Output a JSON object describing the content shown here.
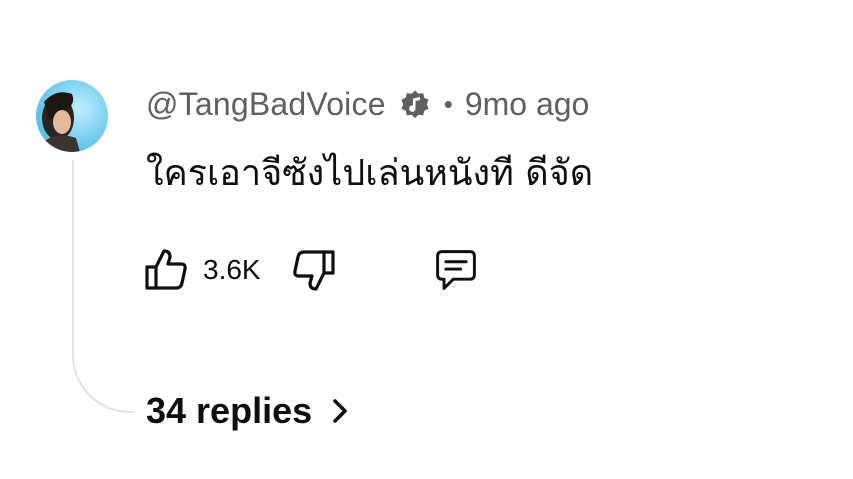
{
  "comment": {
    "author": "@TangBadVoice",
    "badge_icon": "music-note-badge-icon",
    "separator": "•",
    "timestamp": "9mo ago",
    "text": "ใครเอาจีซังไปเล่นหนังที ดีจัด",
    "like_count": "3.6K",
    "icons": {
      "like": "thumbs-up-icon",
      "dislike": "thumbs-down-icon",
      "reply": "reply-comment-icon",
      "replies_chevron": "chevron-right-icon"
    },
    "replies_label": "34 replies"
  },
  "colors": {
    "primary_text": "#0f0f0f",
    "secondary_text": "#606060",
    "thread_line": "#e2e2e2",
    "background": "#ffffff"
  }
}
